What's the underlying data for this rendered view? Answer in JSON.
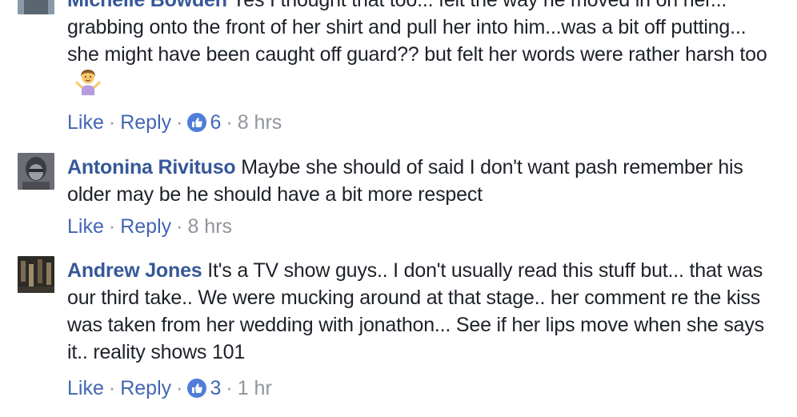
{
  "comments": [
    {
      "author": "Michelle Bowden",
      "text": "Yes I thought that too... felt the way he moved in on her... grabbing onto the front of her shirt and pull her into him...was a bit off putting... she might have been caught off guard?? but felt her words were rather harsh too",
      "emoji": "person-shrugging-emoji",
      "like_label": "Like",
      "reply_label": "Reply",
      "reaction_icon": "like-thumb-icon",
      "reaction_count": "6",
      "time": "8 hrs"
    },
    {
      "author": "Antonina Rivituso",
      "text": "Maybe she should of said I don't want pash remember his older may be he should have a bit more respect",
      "like_label": "Like",
      "reply_label": "Reply",
      "time": "8 hrs"
    },
    {
      "author": "Andrew Jones",
      "text": "It's a TV show guys.. I don't usually read this stuff but... that was our third take.. We were mucking around at that stage.. her comment re the kiss was taken from her wedding with jonathon... See if her lips move when she says it.. reality shows 101",
      "like_label": "Like",
      "reply_label": "Reply",
      "reaction_icon": "like-thumb-icon",
      "reaction_count": "3",
      "time": "1 hr"
    }
  ],
  "separator": "·",
  "colors": {
    "author": "#365899",
    "link": "#4267b2",
    "meta": "#90949c",
    "text": "#1d2129"
  }
}
